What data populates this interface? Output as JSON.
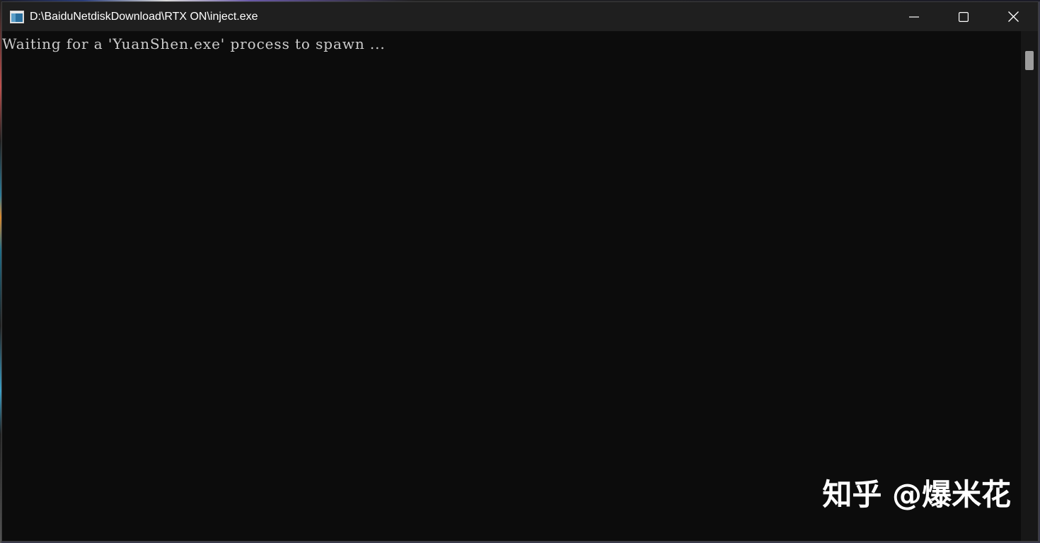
{
  "window": {
    "title": "D:\\BaiduNetdiskDownload\\RTX ON\\inject.exe",
    "app_icon": "console-window-icon",
    "controls": {
      "minimize_icon": "minimize-icon",
      "maximize_icon": "maximize-icon",
      "close_icon": "close-icon"
    }
  },
  "console": {
    "lines": [
      "Waiting for a 'YuanShen.exe' process to spawn ..."
    ],
    "background": "#0c0c0c",
    "text_color": "#cccccc"
  },
  "watermark": {
    "text": "知乎 @爆米花"
  }
}
